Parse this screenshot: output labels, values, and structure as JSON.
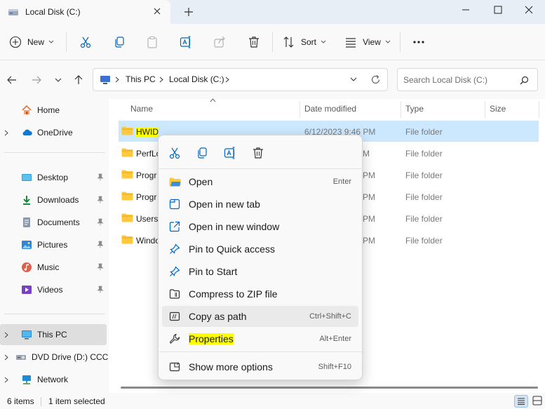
{
  "tab": {
    "title": "Local Disk (C:)"
  },
  "toolbar": {
    "new_label": "New",
    "sort_label": "Sort",
    "view_label": "View"
  },
  "address": {
    "crumbs": [
      "This PC",
      "Local Disk (C:)"
    ],
    "search_placeholder": "Search Local Disk (C:)"
  },
  "nav": {
    "items": [
      {
        "label": "Home"
      },
      {
        "label": "OneDrive"
      },
      {
        "label": "Desktop"
      },
      {
        "label": "Downloads"
      },
      {
        "label": "Documents"
      },
      {
        "label": "Pictures"
      },
      {
        "label": "Music"
      },
      {
        "label": "Videos"
      },
      {
        "label": "This PC"
      },
      {
        "label": "DVD Drive (D:) CCC"
      },
      {
        "label": "Network"
      }
    ]
  },
  "columns": {
    "name": "Name",
    "date": "Date modified",
    "type": "Type",
    "size": "Size"
  },
  "files": [
    {
      "name": "HWID",
      "date": "6/12/2023 9:46 PM",
      "type": "File folder"
    },
    {
      "name": "PerfLo",
      "date": "M",
      "type": "File folder"
    },
    {
      "name": "Progr",
      "date": "PM",
      "type": "File folder"
    },
    {
      "name": "Progr",
      "date": "PM",
      "type": "File folder"
    },
    {
      "name": "Users",
      "date": "PM",
      "type": "File folder"
    },
    {
      "name": "Windo",
      "date": "PM",
      "type": "File folder"
    }
  ],
  "context_menu": {
    "items": [
      {
        "label": "Open",
        "shortcut": "Enter"
      },
      {
        "label": "Open in new tab",
        "shortcut": ""
      },
      {
        "label": "Open in new window",
        "shortcut": ""
      },
      {
        "label": "Pin to Quick access",
        "shortcut": ""
      },
      {
        "label": "Pin to Start",
        "shortcut": ""
      },
      {
        "label": "Compress to ZIP file",
        "shortcut": ""
      },
      {
        "label": "Copy as path",
        "shortcut": "Ctrl+Shift+C"
      },
      {
        "label": "Properties",
        "shortcut": "Alt+Enter"
      },
      {
        "label": "Show more options",
        "shortcut": "Shift+F10"
      }
    ]
  },
  "status": {
    "count": "6 items",
    "selected": "1 item selected"
  },
  "colors": {
    "accent": "#0067c0",
    "highlight": "#ffff00",
    "selection": "#cce8ff",
    "folder": "#ffc83d"
  },
  "icons": [
    "folder-icon",
    "cut-icon",
    "copy-icon",
    "paste-icon",
    "rename-icon",
    "share-icon",
    "delete-icon",
    "sort-icon",
    "view-icon",
    "more-icon",
    "search-icon",
    "refresh-icon",
    "pin-icon",
    "wrench-icon"
  ]
}
